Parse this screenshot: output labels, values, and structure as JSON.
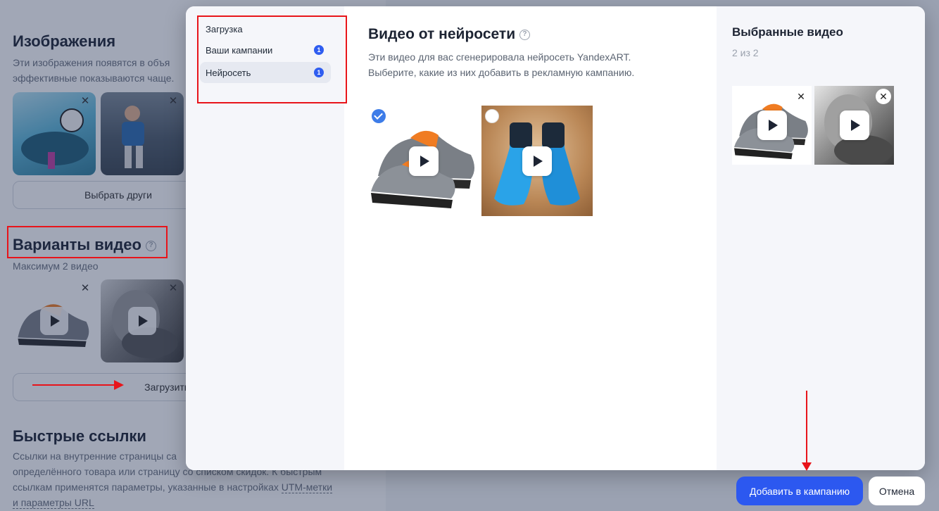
{
  "background": {
    "images_title": "Изображения",
    "images_desc": "Эти изображения появятся в объя",
    "images_desc2": "эффективные показываются чаще.",
    "choose_other_button": "Выбрать други",
    "video_variants_title": "Варианты видео",
    "video_max": "Максимум 2 видео",
    "upload_button": "Загрузить и",
    "quick_links_title": "Быстрые ссылки",
    "quick_links_desc1": "Ссылки на внутренние страницы са",
    "quick_links_desc2": "определённого товара или страницу со списком скидок. К быстрым",
    "quick_links_desc3": "ссылкам применятся параметры, указанные в настройках",
    "utm_link": "UTM-метки",
    "quick_links_desc4": "и параметры URL",
    "help_glyph": "?",
    "close_glyph": "✕"
  },
  "modal": {
    "sidebar": {
      "items": [
        {
          "label": "Загрузка",
          "badge": ""
        },
        {
          "label": "Ваши кампании",
          "badge": "1"
        },
        {
          "label": "Нейросеть",
          "badge": "1",
          "active": true
        }
      ]
    },
    "main": {
      "title": "Видео от нейросети",
      "help_glyph": "?",
      "description_line1": "Эти видео для вас сгенерировала нейросеть YandexART.",
      "description_line2": "Выберите, какие из них добавить в рекламную кампанию.",
      "videos": [
        {
          "subject": "hiking-shoes",
          "selected": true
        },
        {
          "subject": "swim-fins",
          "selected": false
        }
      ]
    },
    "selected": {
      "title": "Выбранные видео",
      "count": "2 из 2",
      "close_glyph": "✕"
    }
  },
  "footer": {
    "add_button": "Добавить в кампанию",
    "cancel_button": "Отмена"
  },
  "colors": {
    "accent": "#2c58f0",
    "badge": "#2f5df0",
    "check": "#3d7ce8",
    "annotation_red": "#e8141a"
  }
}
